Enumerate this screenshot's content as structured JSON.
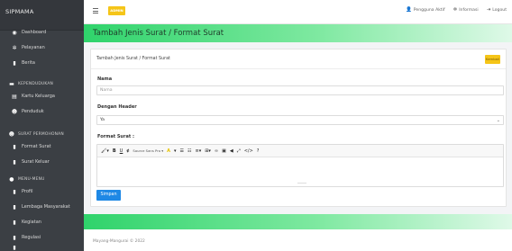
{
  "brand": "SIPMAMA",
  "sidebar": {
    "items": [
      {
        "label": "Dashboard",
        "icon": "dashboard-icon"
      },
      {
        "label": "Pelayanan",
        "icon": "gear-icon"
      },
      {
        "label": "Berita",
        "icon": "document-icon"
      }
    ],
    "section_kependudukan": "KEPENDUDUKAN",
    "kependudukan_items": [
      {
        "label": "Kartu Keluarga",
        "icon": "card-icon"
      },
      {
        "label": "Penduduk",
        "icon": "users-icon"
      }
    ],
    "section_surat": "SURAT PERMOHONAN",
    "surat_items": [
      {
        "label": "Format Surat",
        "icon": "document-icon"
      },
      {
        "label": "Surat Keluar",
        "icon": "document-icon"
      }
    ],
    "section_menu": "MENU-MENU",
    "menu_items": [
      {
        "label": "Profil",
        "icon": "document-icon"
      },
      {
        "label": "Lembaga Masyarakat",
        "icon": "document-icon"
      },
      {
        "label": "Kegiatan",
        "icon": "document-icon"
      },
      {
        "label": "Regulasi",
        "icon": "document-icon"
      }
    ]
  },
  "topbar": {
    "admin_label": "ADMIN",
    "user_label": "Pengguna Aktif",
    "info_label": "Informasi",
    "logout_label": "Logout"
  },
  "page": {
    "title": "Tambah Jenis Surat / Format Surat",
    "breadcrumb": "Tambah Jenis Surat / Format Surat",
    "back_label": "Kembali"
  },
  "form": {
    "nama_label": "Nama",
    "nama_placeholder": "Nama",
    "header_label": "Dengan Header",
    "header_value": "Ya",
    "format_label": "Format Surat :",
    "toolbar_font": "Source Sans Pro",
    "save_label": "Simpan"
  },
  "footer": "Mayang-Mangurai © 2022",
  "colors": {
    "sidebar_bg": "#3b3f44",
    "accent_green": "#2fd36b",
    "accent_yellow": "#f5c518",
    "button_blue": "#1e88e5"
  }
}
